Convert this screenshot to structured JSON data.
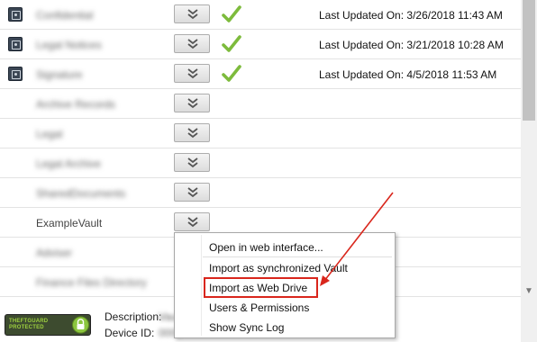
{
  "vaults": [
    {
      "name": "Confidential",
      "blurred": true,
      "icon": "vault-icon",
      "synced": true,
      "updated": "Last Updated On: 3/26/2018 11:43 AM"
    },
    {
      "name": "Legal Notices",
      "blurred": true,
      "icon": "vault-icon",
      "synced": true,
      "updated": "Last Updated On: 3/21/2018 10:28 AM"
    },
    {
      "name": "Signature",
      "blurred": true,
      "icon": "vault-icon",
      "synced": true,
      "updated": "Last Updated On: 4/5/2018 11:53 AM"
    },
    {
      "name": "Archive Records",
      "blurred": true,
      "icon": null,
      "synced": false,
      "updated": ""
    },
    {
      "name": "Legal",
      "blurred": true,
      "icon": null,
      "synced": false,
      "updated": ""
    },
    {
      "name": "Legal Archive",
      "blurred": true,
      "icon": null,
      "synced": false,
      "updated": ""
    },
    {
      "name": "SharedDocuments",
      "blurred": true,
      "icon": null,
      "synced": false,
      "updated": ""
    },
    {
      "name": "ExampleVault",
      "blurred": false,
      "icon": null,
      "synced": false,
      "updated": ""
    },
    {
      "name": "Adviser",
      "blurred": true,
      "icon": null,
      "synced": false,
      "updated": ""
    },
    {
      "name": "Finance Files Directory",
      "blurred": true,
      "icon": null,
      "synced": false,
      "updated": ""
    }
  ],
  "context_menu": {
    "items": [
      "Open in web interface...",
      "Import as synchronized Vault",
      "Import as Web Drive",
      "Users & Permissions",
      "Show Sync Log"
    ],
    "highlighted_index": 2,
    "highlight_color": "#d9261c"
  },
  "footer": {
    "badge_text": "THEFTGUARD PROTECTED",
    "description_label": "Description:",
    "description_value": "Vault",
    "device_label": "Device ID:",
    "device_value": "0000"
  },
  "colors": {
    "check": "#7dbb3c",
    "annotation": "#d9261c"
  }
}
